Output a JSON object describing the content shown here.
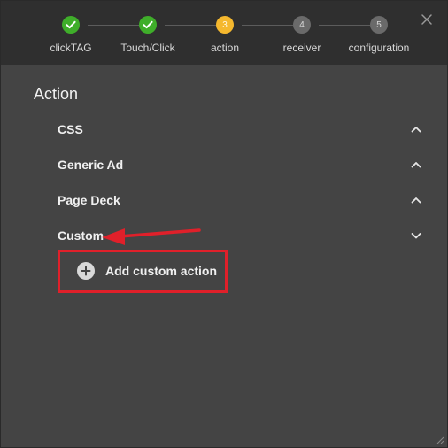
{
  "wizard": {
    "steps": [
      {
        "label": "clickTAG",
        "number": "1",
        "state": "done"
      },
      {
        "label": "Touch/Click",
        "number": "2",
        "state": "done"
      },
      {
        "label": "action",
        "number": "3",
        "state": "active"
      },
      {
        "label": "receiver",
        "number": "4",
        "state": "pending"
      },
      {
        "label": "configuration",
        "number": "5",
        "state": "pending"
      }
    ],
    "close_icon": "close-icon"
  },
  "section": {
    "title": "Action",
    "items": [
      {
        "label": "CSS",
        "expanded": false
      },
      {
        "label": "Generic Ad",
        "expanded": false
      },
      {
        "label": "Page Deck",
        "expanded": false
      },
      {
        "label": "Custom",
        "expanded": true
      }
    ],
    "add_custom_label": "Add custom action"
  },
  "colors": {
    "panel_bg": "#444444",
    "header_bg": "#2f2f2f",
    "step_done": "#3fae2a",
    "step_active": "#f5b82e",
    "step_pending": "#6a6a6a",
    "annotation_red": "#e0202a"
  }
}
